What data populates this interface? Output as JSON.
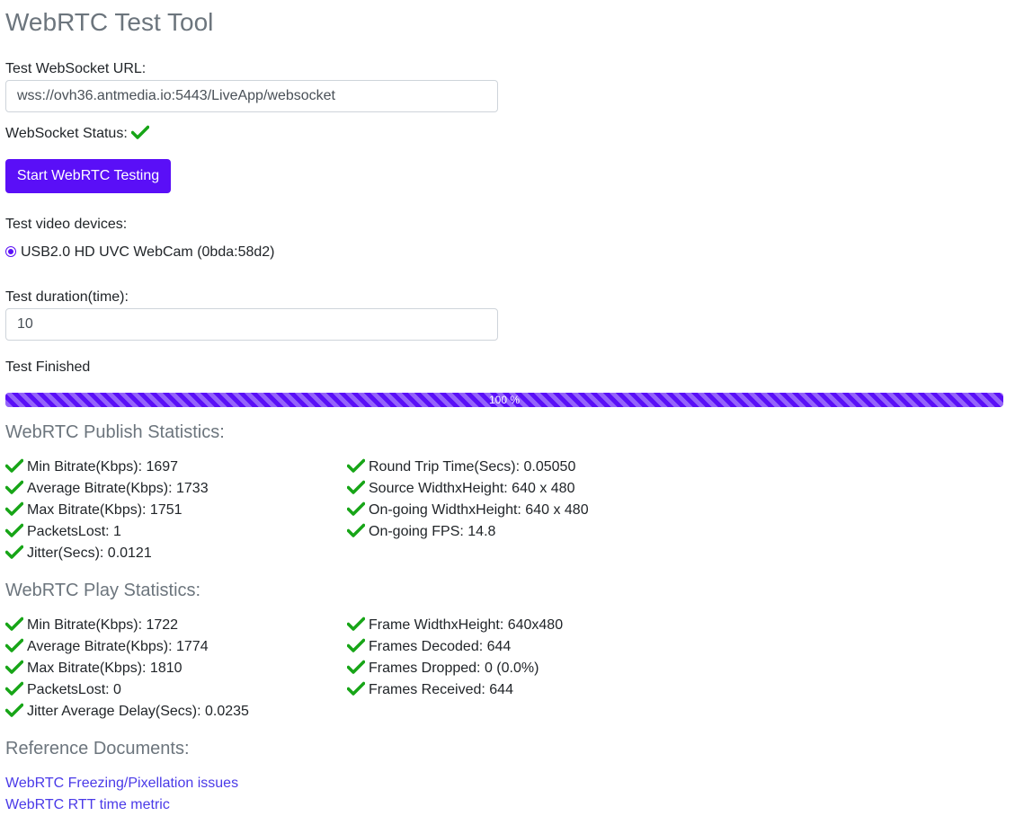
{
  "page": {
    "title": "WebRTC Test Tool"
  },
  "websocket": {
    "label": "Test WebSocket URL:",
    "url": "wss://ovh36.antmedia.io:5443/LiveApp/websocket",
    "status_label": "WebSocket Status:",
    "status": "connected"
  },
  "start_button": {
    "label": "Start WebRTC Testing"
  },
  "devices": {
    "label": "Test video devices:",
    "selected": "USB2.0 HD UVC WebCam (0bda:58d2)"
  },
  "duration": {
    "label": "Test duration(time):",
    "value": "10"
  },
  "test_status": "Test Finished",
  "progress": {
    "value": 100,
    "label": "100 %"
  },
  "publish_stats": {
    "heading": "WebRTC Publish Statistics:",
    "left": [
      "Min Bitrate(Kbps): 1697",
      "Average Bitrate(Kbps): 1733",
      "Max Bitrate(Kbps): 1751",
      "PacketsLost: 1",
      "Jitter(Secs): 0.0121"
    ],
    "right": [
      "Round Trip Time(Secs): 0.05050",
      "Source WidthxHeight: 640 x 480",
      "On-going WidthxHeight: 640 x 480",
      "On-going FPS: 14.8"
    ]
  },
  "play_stats": {
    "heading": "WebRTC Play Statistics:",
    "left": [
      "Min Bitrate(Kbps): 1722",
      "Average Bitrate(Kbps): 1774",
      "Max Bitrate(Kbps): 1810",
      "PacketsLost: 0",
      "Jitter Average Delay(Secs): 0.0235"
    ],
    "right": [
      "Frame WidthxHeight: 640x480",
      "Frames Decoded: 644",
      "Frames Dropped: 0 (0.0%)",
      "Frames Received: 644"
    ]
  },
  "references": {
    "heading": "Reference Documents:",
    "links": [
      "WebRTC Freezing/Pixellation issues",
      "WebRTC RTT time metric"
    ]
  },
  "colors": {
    "accent": "#5a0ff7",
    "check": "#17a517",
    "link": "#4a3ae8",
    "muted": "#6c757d"
  },
  "icons": {
    "check": "check-icon"
  }
}
